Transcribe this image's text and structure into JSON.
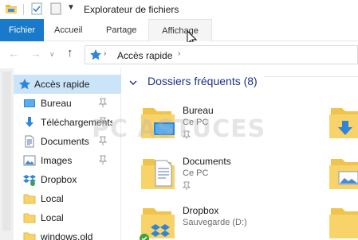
{
  "window": {
    "title": "Explorateur de fichiers"
  },
  "ribbon": {
    "tabs": [
      {
        "label": "Fichier",
        "active": true
      },
      {
        "label": "Accueil"
      },
      {
        "label": "Partage"
      },
      {
        "label": "Affichage",
        "hover": true
      }
    ]
  },
  "address": {
    "path": "Accès rapide"
  },
  "sidebar": {
    "items": [
      {
        "label": "Accès rapide",
        "icon": "star-icon",
        "selected": true
      },
      {
        "label": "Bureau",
        "icon": "desktop-icon",
        "pinned": true
      },
      {
        "label": "Téléchargements",
        "icon": "download-arrow-icon",
        "pinned": true
      },
      {
        "label": "Documents",
        "icon": "document-icon",
        "pinned": true
      },
      {
        "label": "Images",
        "icon": "images-icon",
        "pinned": true
      },
      {
        "label": "Dropbox",
        "icon": "dropbox-icon"
      },
      {
        "label": "Local",
        "icon": "folder-icon"
      },
      {
        "label": "Local",
        "icon": "folder-icon"
      },
      {
        "label": "windows.old",
        "icon": "folder-icon"
      }
    ]
  },
  "main": {
    "group_title": "Dossiers fréquents (8)",
    "folders": [
      {
        "name": "Bureau",
        "location": "Ce PC",
        "pinned": true
      },
      {
        "name": "Documents",
        "location": "Ce PC",
        "pinned": true
      },
      {
        "name": "Dropbox",
        "location": "Sauvegarde (D:)"
      }
    ]
  },
  "watermark": "PC ASTUCES",
  "colors": {
    "accent": "#1979ca",
    "selection": "#cce4f7",
    "folder": "#f7d36a",
    "group_title": "#1e3287"
  }
}
